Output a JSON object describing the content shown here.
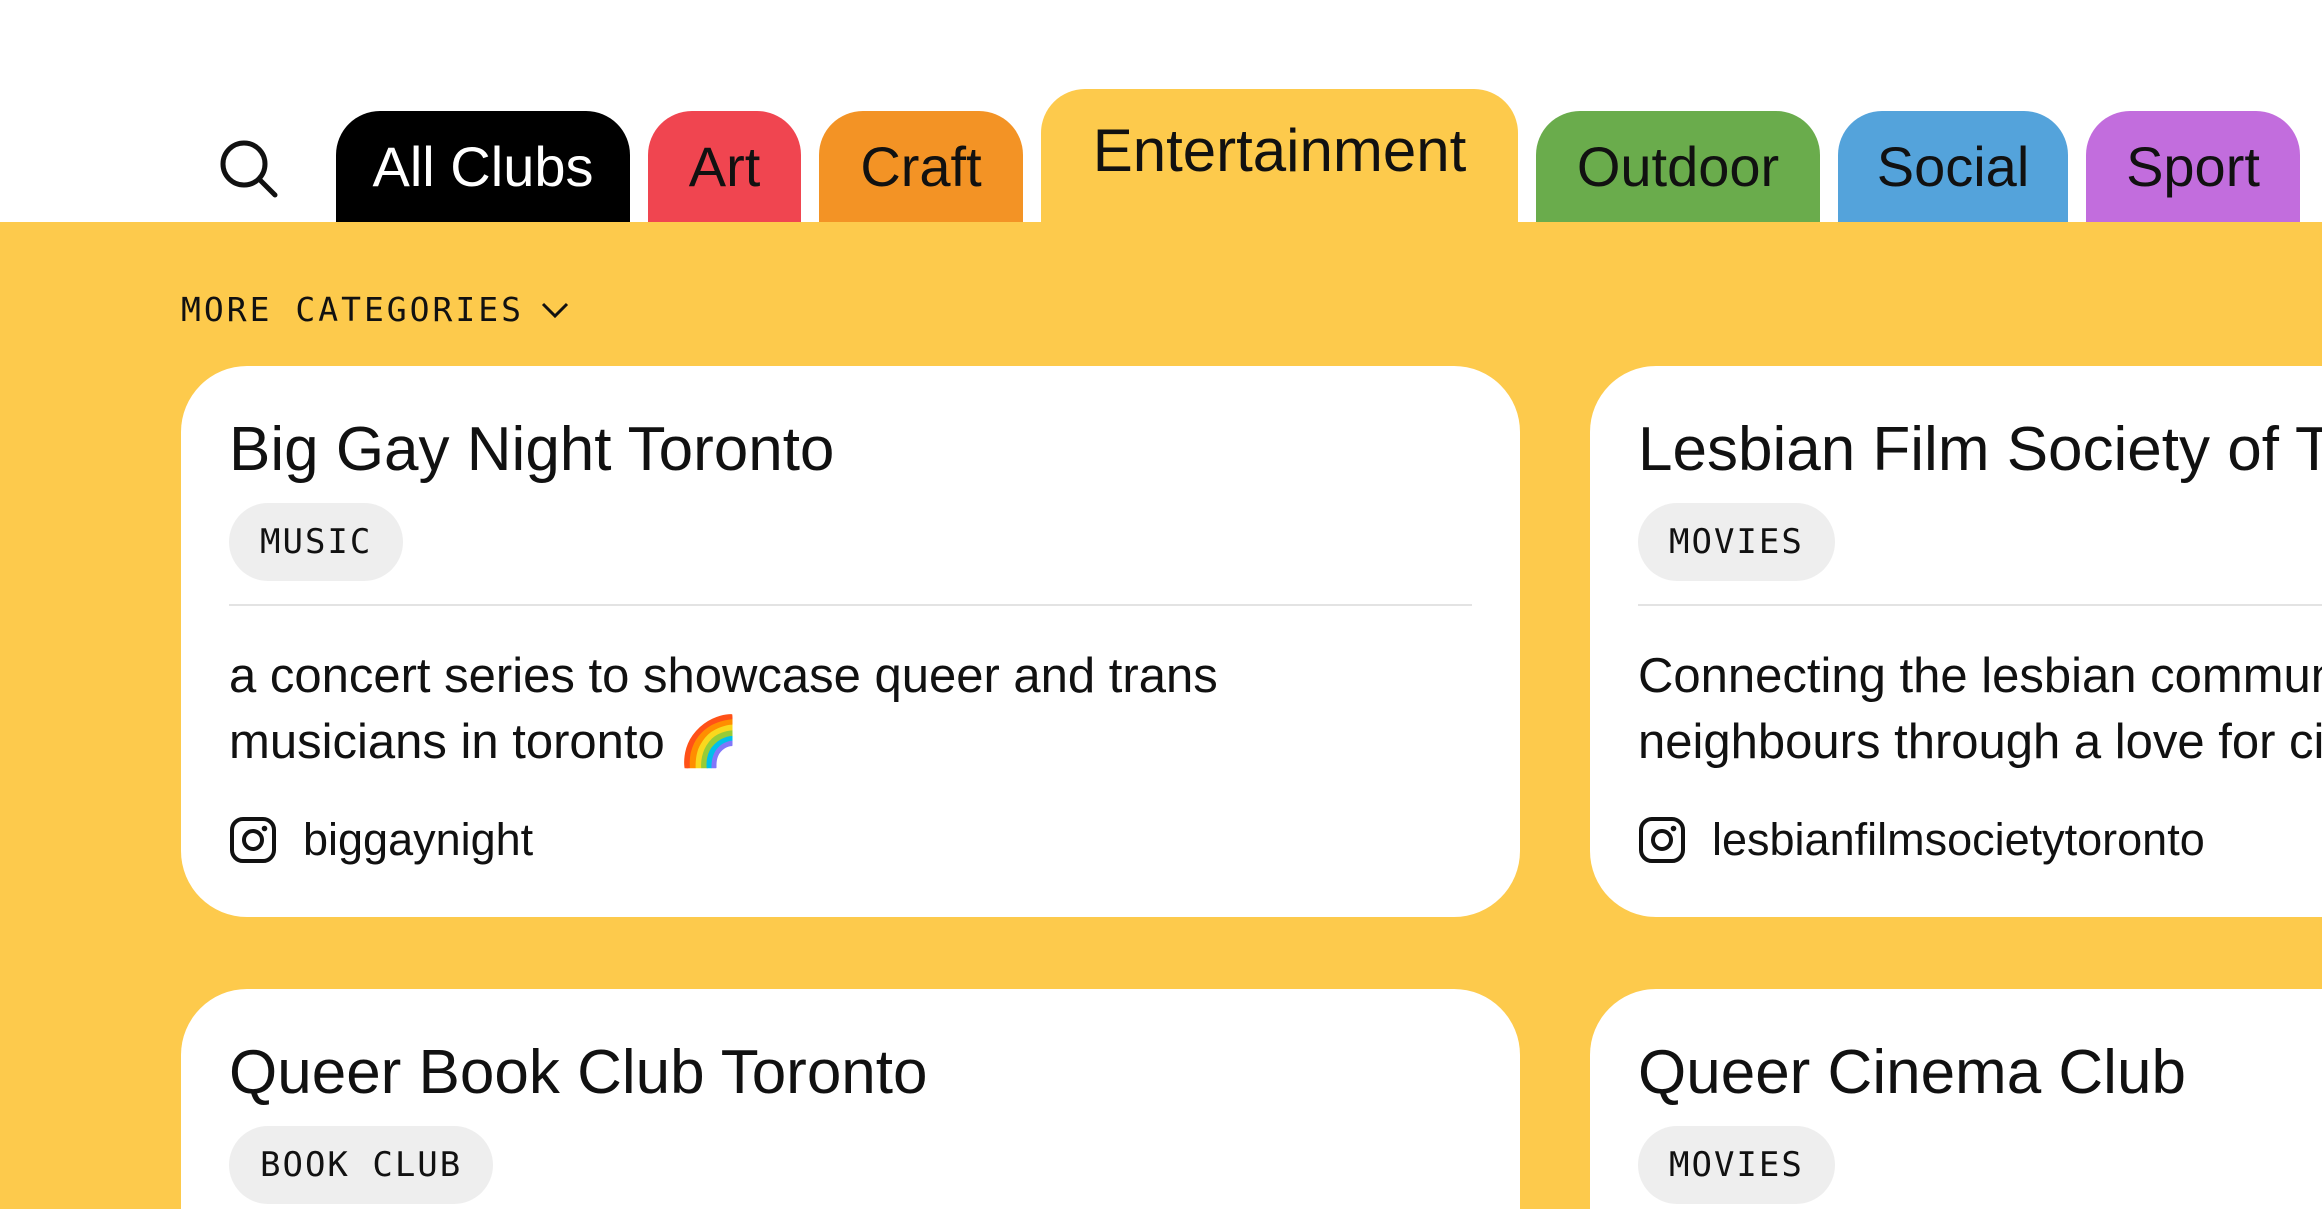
{
  "search": {
    "icon": "search-icon"
  },
  "tabs": [
    {
      "label": "All Clubs",
      "color": "#000000",
      "text_color": "#ffffff",
      "active": false
    },
    {
      "label": "Art",
      "color": "#f04550",
      "text_color": "#111111",
      "active": false
    },
    {
      "label": "Craft",
      "color": "#f39325",
      "text_color": "#111111",
      "active": false
    },
    {
      "label": "Entertainment",
      "color": "#fdca4c",
      "text_color": "#111111",
      "active": true
    },
    {
      "label": "Outdoor",
      "color": "#6aac4c",
      "text_color": "#111111",
      "active": false
    },
    {
      "label": "Social",
      "color": "#54a3db",
      "text_color": "#111111",
      "active": false
    },
    {
      "label": "Sport",
      "color": "#c26ddd",
      "text_color": "#111111",
      "active": false
    }
  ],
  "more_categories": {
    "label": "MORE CATEGORIES",
    "icon": "chevron-down-icon"
  },
  "colors": {
    "background": "#fdca4c",
    "card": "#ffffff",
    "tag": "#eeeeee"
  },
  "clubs": [
    {
      "title": "Big Gay Night Toronto",
      "tag": "MUSIC",
      "description": [
        "a concert series to showcase queer and trans",
        "musicians in toronto 🌈"
      ],
      "instagram": "biggaynight"
    },
    {
      "title": "Lesbian Film Society of Toronto",
      "tag": "MOVIES",
      "description": [
        "Connecting the lesbian community and",
        "neighbours through a love for cinema"
      ],
      "instagram": "lesbianfilmsocietytoronto"
    },
    {
      "title": "Queer Book Club Toronto",
      "tag": "BOOK CLUB"
    },
    {
      "title": "Queer Cinema Club",
      "tag": "MOVIES"
    }
  ]
}
